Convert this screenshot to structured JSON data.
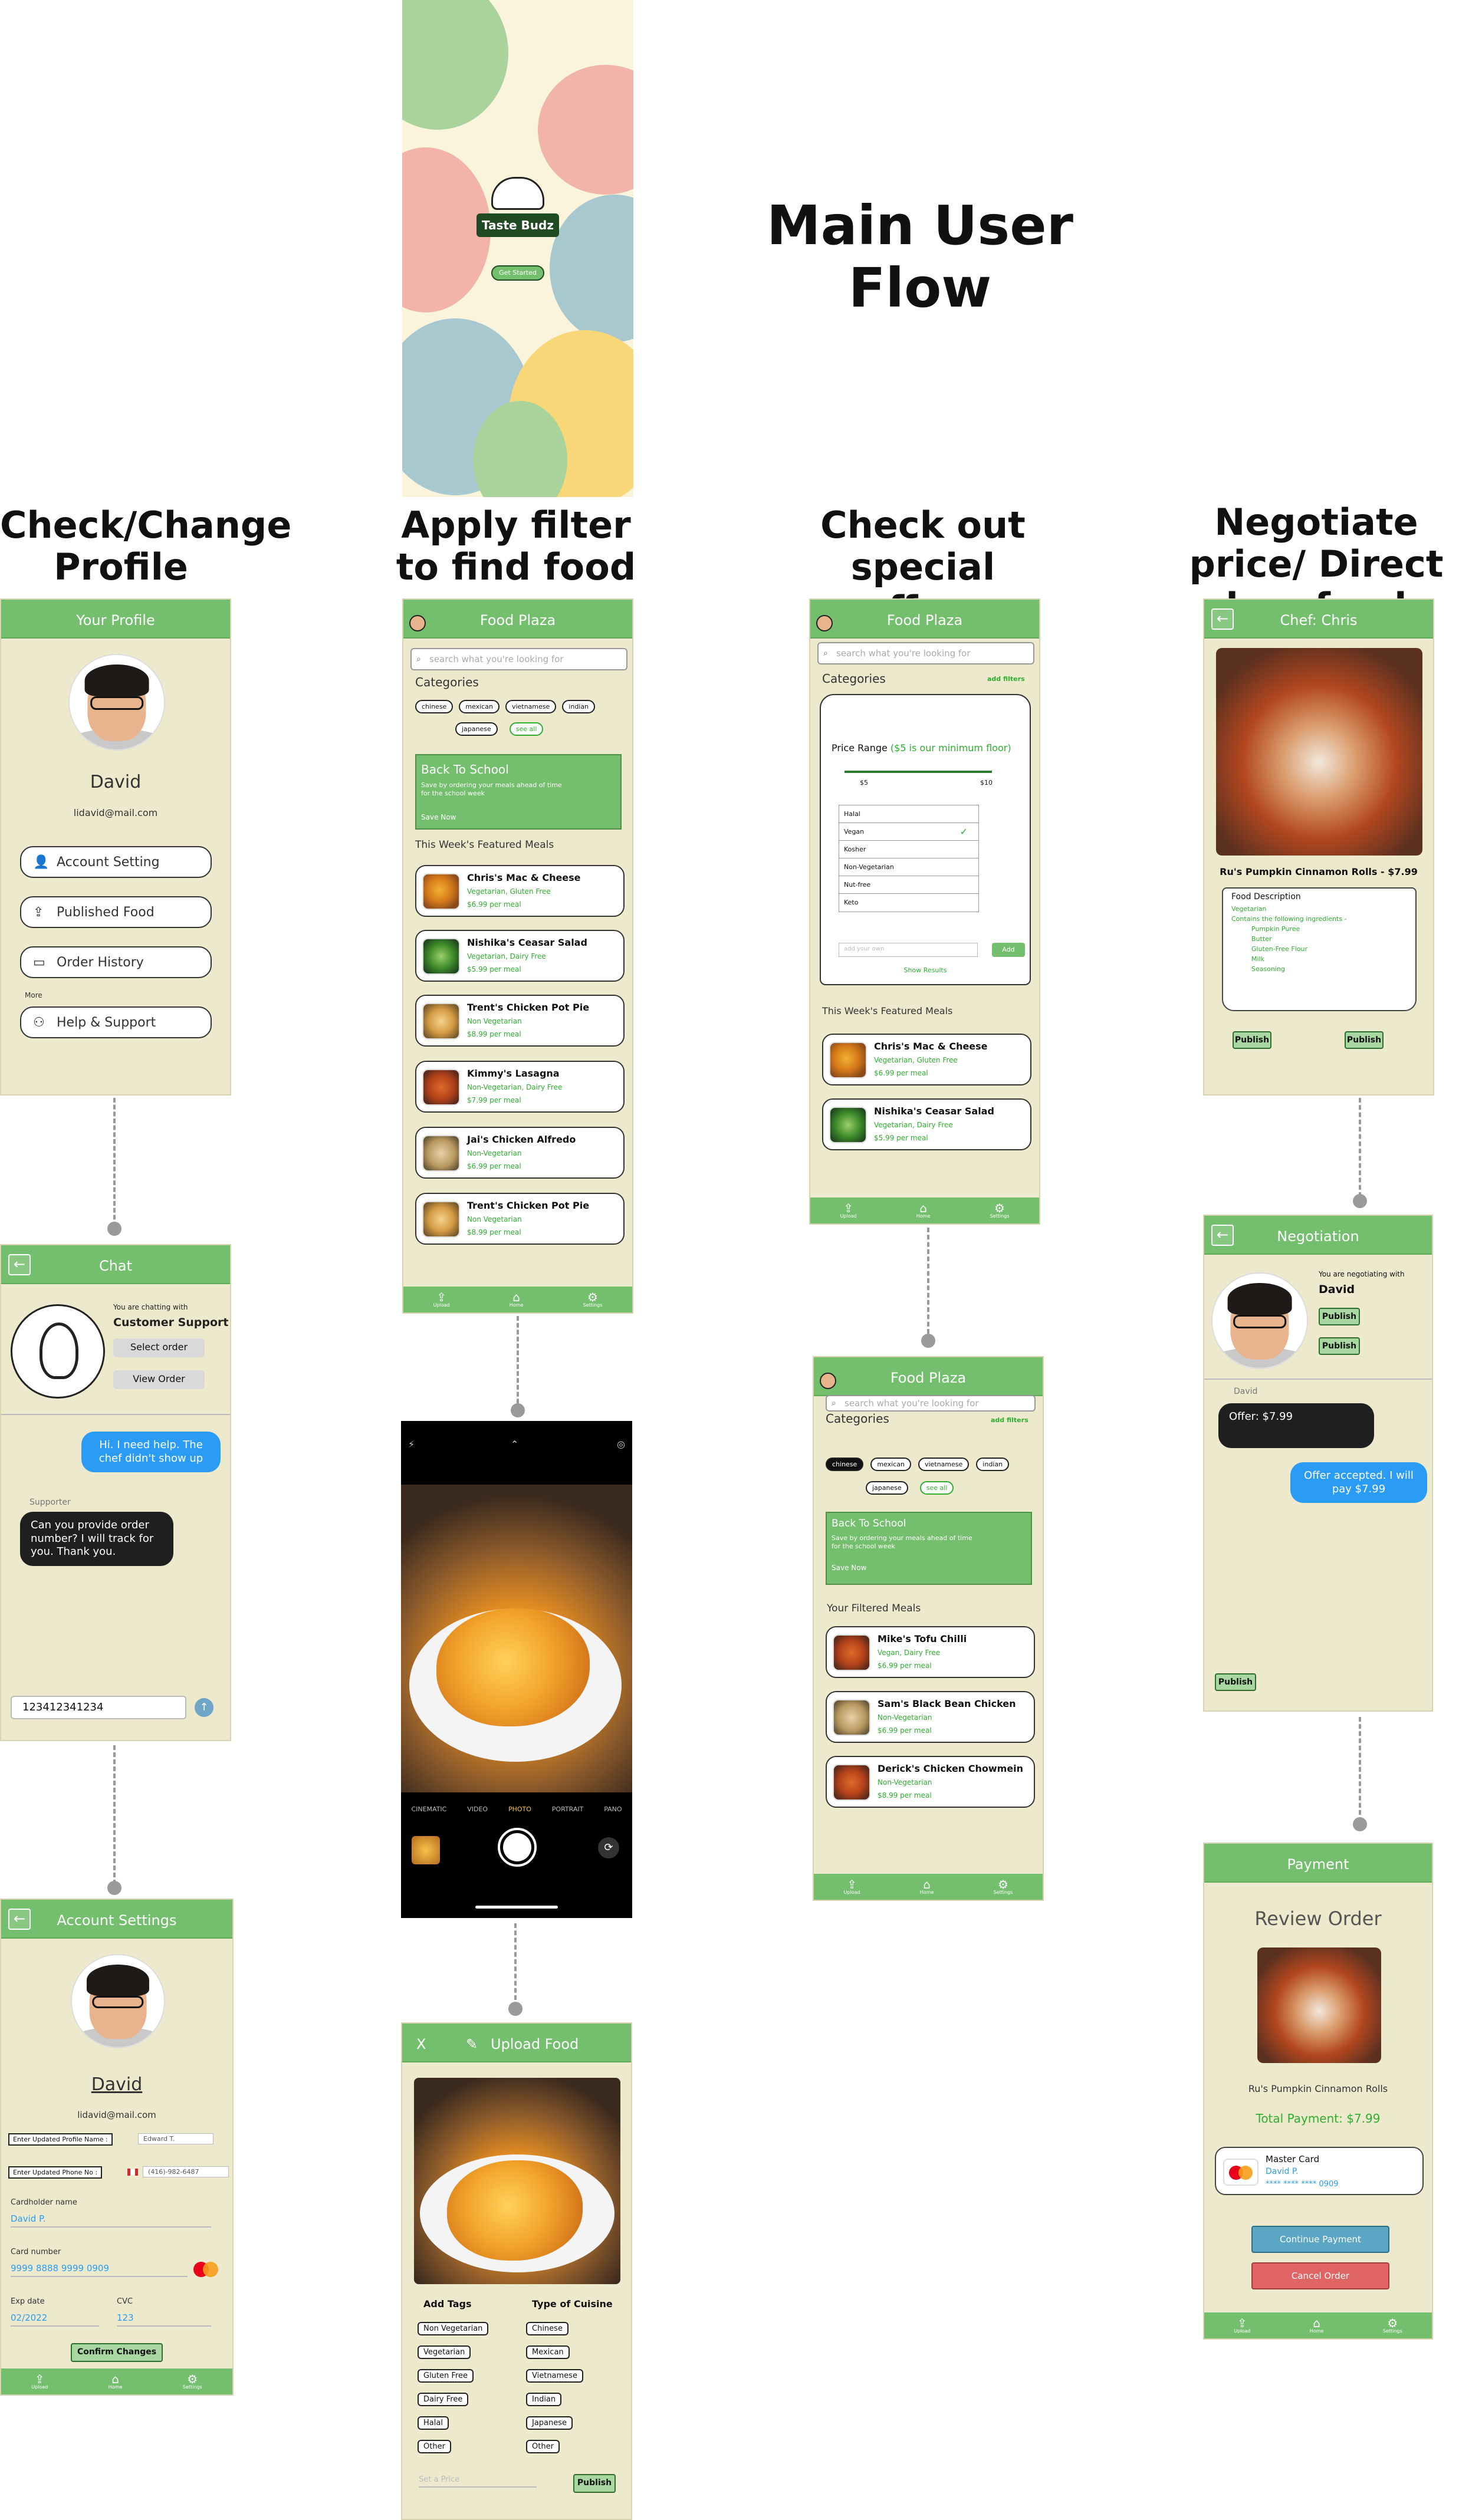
{
  "titles": {
    "main": "Main User Flow",
    "col1": "Check/Change Profile",
    "col2": "Apply filter to find food",
    "col3": "Check out special offers",
    "col4": "Negotiate price/ Direct buy food"
  },
  "splash": {
    "brand": "Taste Budz",
    "cta": "Get Started"
  },
  "profile": {
    "header": "Your Profile",
    "name": "David",
    "email": "lidavid@mail.com",
    "menu": [
      "Account Setting",
      "Published Food",
      "Order History"
    ],
    "more": "More",
    "help": "Help & Support"
  },
  "chat": {
    "header": "Chat",
    "chatting_with": "You are chatting with",
    "agent": "Customer Support",
    "select_order": "Select order",
    "view_order": "View Order",
    "msg_user": "Hi. I need help. The chef didn't show up",
    "sender": "Supporter",
    "msg_support": "Can you provide order number? I will track for you. Thank you.",
    "input_value": "123412341234"
  },
  "account_settings": {
    "header": "Account Settings",
    "name": "David",
    "email": "lidavid@mail.com",
    "profile_name_label": "Enter Updated Profile Name :",
    "profile_name_value": "Edward T.",
    "phone_label": "Enter Updated Phone No :",
    "phone_value": "(416)-982-6487",
    "cardholder_label": "Cardholder name",
    "cardholder_value": "David P.",
    "card_number_label": "Card number",
    "card_number_value": "9999 8888 9999 0909",
    "exp_label": "Exp date",
    "exp_value": "02/2022",
    "cvc_label": "CVC",
    "cvc_value": "123",
    "confirm": "Confirm Changes"
  },
  "food_plaza": {
    "header": "Food Plaza",
    "search_placeholder": "search what you're looking for",
    "categories_label": "Categories",
    "add_filters": "add filters",
    "categories": [
      "chinese",
      "mexican",
      "vietnamese",
      "indian",
      "japanese",
      "see all"
    ],
    "banner_title": "Back To School",
    "banner_text": "Save by ordering your meals ahead of time for the school week",
    "banner_cta": "Save Now",
    "featured_label": "This Week's Featured Meals",
    "meals": [
      {
        "name": "Chris's Mac & Cheese",
        "tags": "Vegetarian, Gluten Free",
        "price": "$6.99 per meal"
      },
      {
        "name": "Nishika's Ceasar Salad",
        "tags": "Vegetarian, Dairy Free",
        "price": "$5.99 per meal"
      },
      {
        "name": "Trent's Chicken Pot Pie",
        "tags": "Non Vegetarian",
        "price": "$8.99 per meal"
      },
      {
        "name": "Kimmy's Lasagna",
        "tags": "Non-Vegetarian, Dairy Free",
        "price": "$7.99 per meal"
      },
      {
        "name": "Jai's Chicken Alfredo",
        "tags": "Non-Vegetarian",
        "price": "$6.99 per meal"
      },
      {
        "name": "Trent's Chicken Pot Pie",
        "tags": "Non Vegetarian",
        "price": "$8.99 per meal"
      }
    ],
    "nav": [
      "Upload",
      "Home",
      "Settings"
    ]
  },
  "camera": {
    "modes": [
      "CINEMATIC",
      "VIDEO",
      "PHOTO",
      "PORTRAIT",
      "PANO"
    ]
  },
  "upload_food": {
    "close": "X",
    "header": "Upload Food",
    "add_tags_label": "Add Tags",
    "cuisine_label": "Type of Cuisine",
    "tags": [
      "Non Vegetarian",
      "Vegetarian",
      "Gluten Free",
      "Dairy Free",
      "Halal",
      "Other"
    ],
    "cuisines": [
      "Chinese",
      "Mexican",
      "Vietnamese",
      "Indian",
      "Japanese",
      "Other"
    ],
    "price_placeholder": "Set a Price",
    "publish": "Publish"
  },
  "filter_screen": {
    "price_range_label": "Price Range",
    "price_range_note": "($5 is our minimum floor)",
    "min": "$5",
    "max": "$10",
    "diet_options": [
      "Halal",
      "Vegan",
      "Kosher",
      "Non-Vegetarian",
      "Nut-free",
      "Keto"
    ],
    "selected": "Vegan",
    "own_input_placeholder": "add your own",
    "add": "Add",
    "show_results": "Show Results",
    "featured_meals": [
      {
        "name": "Chris's Mac & Cheese",
        "tags": "Vegetarian, Gluten Free",
        "price": "$6.99 per meal"
      },
      {
        "name": "Nishika's Ceasar Salad",
        "tags": "Vegetarian, Dairy Free",
        "price": "$5.99 per meal"
      }
    ]
  },
  "filtered": {
    "label": "Your Filtered Meals",
    "banner_title": "Back To School",
    "meals": [
      {
        "name": "Mike's Tofu Chilli",
        "tags": "Vegan, Dairy Free",
        "price": "$6.99 per meal"
      },
      {
        "name": "Sam's Black Bean Chicken",
        "tags": "Non-Vegetarian",
        "price": "$6.99 per meal"
      },
      {
        "name": "Derick's Chicken Chowmein",
        "tags": "Non-Vegetarian",
        "price": "$8.99 per meal"
      }
    ]
  },
  "chef": {
    "header": "Chef: Chris",
    "dish": "Ru's Pumpkin Cinnamon Rolls - $7.99",
    "desc_title": "Food Description",
    "desc_items": [
      "Vegetarian",
      "Contains the following ingredients -"
    ],
    "ingredients": [
      "Pumpkin Puree",
      "Butter",
      "Gluten-Free Flour",
      "Milk",
      "Seasoning"
    ],
    "buttons": [
      "Publish",
      "Publish"
    ]
  },
  "negotiation": {
    "header": "Negotiation",
    "intro": "You are negotiating with",
    "name": "David",
    "buttons": [
      "Publish",
      "Publish"
    ],
    "sender": "David",
    "offer": "Offer: $7.99",
    "reply": "Offer accepted. I will pay $7.99",
    "publish": "Publish"
  },
  "payment": {
    "header": "Payment",
    "review": "Review Order",
    "dish": "Ru's Pumpkin Cinnamon Rolls",
    "total": "Total Payment: $7.99",
    "card_brand": "Master Card",
    "card_holder": "David P.",
    "card_masked": "**** **** **** 0909",
    "continue": "Continue Payment",
    "cancel": "Cancel Order"
  },
  "colors": {
    "header_green": "#74bf6e",
    "screen_bg": "#ece9cc",
    "accent_green": "#2fae2f",
    "chat_blue": "#2b9cf5",
    "cancel_red": "#e16464",
    "continue_blue": "#5aa6c4"
  }
}
